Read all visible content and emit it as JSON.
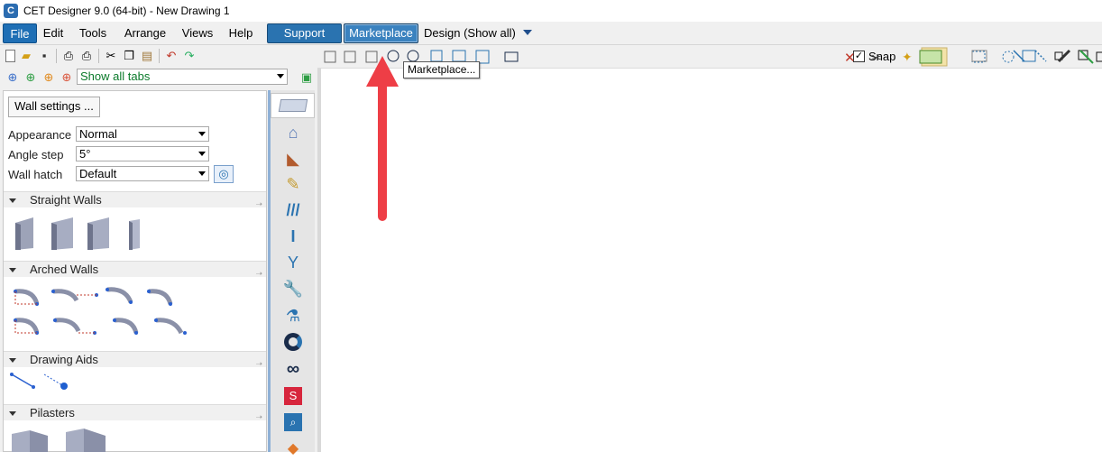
{
  "window": {
    "title": "CET Designer 9.0 (64-bit) - New Drawing 1",
    "app_icon": "cet-app-icon"
  },
  "menubar": {
    "items": [
      "File",
      "Edit",
      "Tools",
      "Arrange",
      "Views",
      "Help"
    ],
    "support_label": "Support",
    "marketplace_label": "Marketplace",
    "design_label": "Design (Show all)"
  },
  "left_toolbar": {
    "icons": [
      "new-icon",
      "open-icon",
      "save-icon",
      "print-preview-icon",
      "print-icon",
      "cut-icon",
      "copy-icon",
      "paste-icon",
      "undo-icon",
      "redo-icon"
    ],
    "tabs_filter": "Show all tabs"
  },
  "wall_panel": {
    "settings_button": "Wall settings ...",
    "appearance_label": "Appearance",
    "appearance_value": "Normal",
    "angle_step_label": "Angle step",
    "angle_step_value": "5°",
    "wall_hatch_label": "Wall hatch",
    "wall_hatch_value": "Default",
    "sections": [
      "Straight Walls",
      "Arched Walls",
      "Drawing Aids",
      "Pilasters"
    ]
  },
  "canvas_toolbar": {
    "snap_label": "Snap",
    "snap_checked": true
  },
  "tooltip": {
    "text": "Marketplace..."
  },
  "colors": {
    "menu_blue": "#2a73b0",
    "arrow_red": "#ee3e46"
  }
}
